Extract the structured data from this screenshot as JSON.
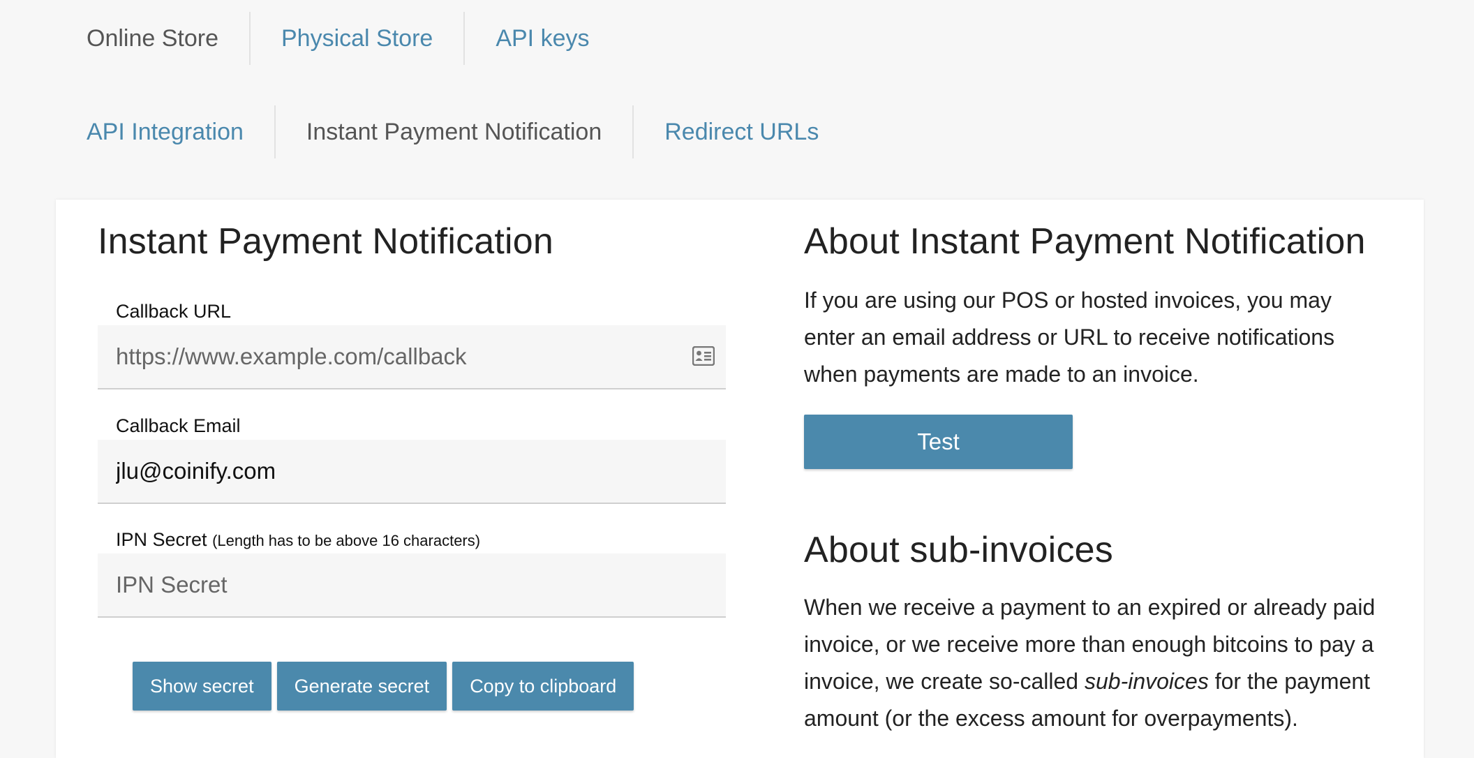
{
  "tabs_primary": [
    {
      "label": "Online Store",
      "active": true
    },
    {
      "label": "Physical Store",
      "active": false
    },
    {
      "label": "API keys",
      "active": false
    }
  ],
  "tabs_secondary": [
    {
      "label": "API Integration",
      "active": false
    },
    {
      "label": "Instant Payment Notification",
      "active": true
    },
    {
      "label": "Redirect URLs",
      "active": false
    }
  ],
  "form": {
    "title": "Instant Payment Notification",
    "callback_url": {
      "label": "Callback URL",
      "placeholder": "https://www.example.com/callback",
      "value": "",
      "icon": "contact-card-icon"
    },
    "callback_email": {
      "label": "Callback Email",
      "value": "jlu@coinify.com"
    },
    "ipn_secret": {
      "label": "IPN Secret",
      "hint": "(Length has to be above 16 characters)",
      "placeholder": "IPN Secret",
      "value": ""
    },
    "buttons": {
      "show": "Show secret",
      "generate": "Generate secret",
      "copy": "Copy to clipboard"
    }
  },
  "about": {
    "title": "About Instant Payment Notification",
    "text": "If you are using our POS or hosted invoices, you may enter an email address or URL to receive notifications when payments are made to an invoice.",
    "test_label": "Test",
    "sub_title": "About sub-invoices",
    "sub_text_before": "When we receive a payment to an expired or already paid invoice, or we receive more than enough bitcoins to pay a invoice, we create so-called ",
    "sub_text_em": "sub-invoices",
    "sub_text_after": " for the payment amount (or the excess amount for overpayments)."
  },
  "colors": {
    "accent": "#4b89ac",
    "link": "#4a88ad"
  }
}
